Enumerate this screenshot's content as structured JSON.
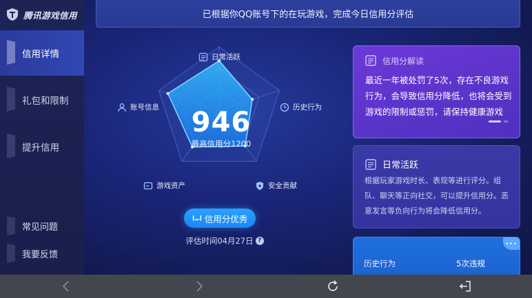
{
  "app": {
    "logo_text": "腾讯游戏信用"
  },
  "sidebar": {
    "items": [
      {
        "label": "信用详情",
        "active": true
      },
      {
        "label": "礼包和限制",
        "active": false
      },
      {
        "label": "提升信用",
        "active": false
      }
    ],
    "bottom_items": [
      {
        "label": "常见问题"
      },
      {
        "label": "我要反馈"
      }
    ]
  },
  "banner": {
    "text": "已根据你QQ账号下的在玩游戏，完成今日信用分评估"
  },
  "radar": {
    "axes": [
      {
        "label": "日常活跃",
        "icon": "document-icon"
      },
      {
        "label": "历史行为",
        "icon": "clock-icon"
      },
      {
        "label": "安全贡献",
        "icon": "shield-icon"
      },
      {
        "label": "游戏资产",
        "icon": "wallet-icon"
      },
      {
        "label": "账号信息",
        "icon": "user-icon"
      }
    ],
    "levels": [
      0.78,
      0.55,
      0.7,
      0.72,
      0.85
    ],
    "score": "946",
    "score_sub": "最高信用分1200",
    "rating": "信用分优秀",
    "eval_time": "评估时间04月27日"
  },
  "cards": {
    "interpretation": {
      "title": "信用分解读",
      "body": "最近一年被处罚了5次，存在不良游戏行为，会导致信用分降低，也将会受到游戏的限制或惩罚，请保持健康游戏"
    },
    "daily": {
      "title": "日常活跃",
      "body": "根据玩家游戏时长、表现等进行评分。组队、聊天等正向社交，可以提升信用分。恶意发言等负向行为将会降低信用分。"
    },
    "history": {
      "label": "历史行为",
      "value": "5次违规",
      "corner": "•••"
    }
  },
  "colors": {
    "accent": "#1f8cf5",
    "card_purple": "#5a33c9",
    "card_indigo": "#3434a0",
    "card_blue": "#1d63d0",
    "radar_fill": "#2aa8ff"
  }
}
